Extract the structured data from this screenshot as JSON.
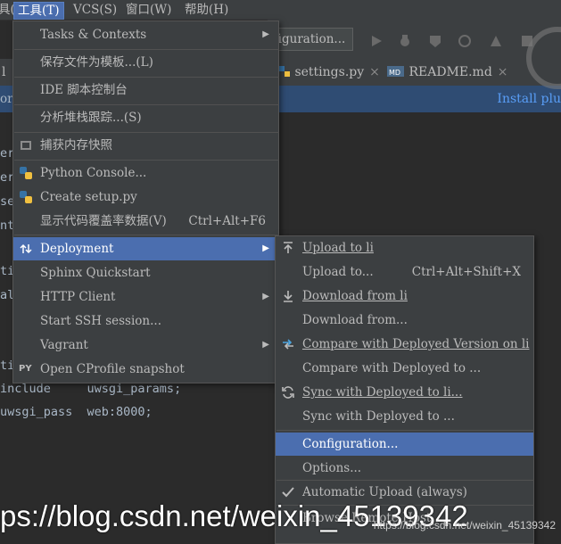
{
  "menubar": {
    "items": [
      {
        "label": "具(I)",
        "active": false
      },
      {
        "label": "工具(T)",
        "active": true
      },
      {
        "label": "VCS(S)",
        "active": false
      },
      {
        "label": "窗口(W)",
        "active": false
      },
      {
        "label": "帮助(H)",
        "active": false
      }
    ]
  },
  "toolbar": {
    "run_config_label": "figuration..."
  },
  "tabs": [
    {
      "label": "l"
    },
    {
      "label": "settings.py",
      "close": "×"
    },
    {
      "label": "README.md",
      "close": "×"
    }
  ],
  "banner": {
    "left_text": "or",
    "install_link": "Install plu"
  },
  "editor": {
    "lines": [
      "er",
      "er",
      "se",
      "nt",
      "",
      "",
      "ti",
      "al",
      "",
      "",
      "ti",
      "include     uwsgi_params;",
      "uwsgi_pass  web:8000;"
    ]
  },
  "tools_menu": {
    "items": [
      {
        "label": "Tasks & Contexts",
        "submenu": true
      },
      {
        "label": "保存文件为模板...(L)"
      },
      {
        "label": "IDE 脚本控制台"
      },
      {
        "label": "分析堆栈跟踪...(S)"
      },
      {
        "label": "捕获内存快照",
        "icon": "memory-snapshot-icon"
      },
      {
        "label": "Python Console...",
        "icon": "python-icon"
      },
      {
        "label": "Create setup.py",
        "icon": "python-file-icon"
      },
      {
        "label": "显示代码覆盖率数据(V)",
        "shortcut": "Ctrl+Alt+F6"
      },
      {
        "label": "Deployment",
        "submenu": true,
        "selected": true,
        "icon": "deployment-icon"
      },
      {
        "label": "Sphinx Quickstart"
      },
      {
        "label": "HTTP Client",
        "submenu": true
      },
      {
        "label": "Start SSH session..."
      },
      {
        "label": "Vagrant",
        "submenu": true
      },
      {
        "label": "Open CProfile snapshot",
        "icon": "profile-icon",
        "icon_text": "PY"
      }
    ]
  },
  "deploy_menu": {
    "items": [
      {
        "label": "Upload to li",
        "icon": "upload-icon"
      },
      {
        "label": "Upload to...",
        "shortcut": "Ctrl+Alt+Shift+X"
      },
      {
        "label": "Download from li",
        "icon": "download-icon"
      },
      {
        "label": "Download from..."
      },
      {
        "label": "Compare with Deployed Version on li",
        "icon": "compare-icon"
      },
      {
        "label": "Compare with Deployed to ..."
      },
      {
        "label": "Sync with Deployed to li...",
        "icon": "sync-icon"
      },
      {
        "label": "Sync with Deployed to ..."
      },
      {
        "label": "Configuration...",
        "selected": true
      },
      {
        "label": "Options..."
      },
      {
        "label": "Automatic Upload (always)",
        "icon": "check-icon"
      },
      {
        "label": "Browse Remote Host"
      }
    ]
  },
  "watermark": {
    "text": "ps://blog.csdn.net/weixin_45139342",
    "small": "https://blog.csdn.net/weixin_45139342"
  },
  "colors": {
    "accent": "#4b6eaf",
    "menu_bg": "#3c3f41",
    "editor_bg": "#2b2b2b",
    "link": "#589df6"
  }
}
